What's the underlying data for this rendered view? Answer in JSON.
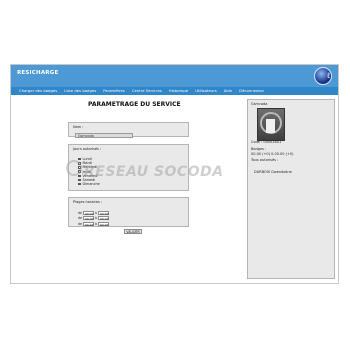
{
  "app": {
    "name": "RESICHARGE",
    "logo_icon": "globe-logo-icon"
  },
  "nav": {
    "items": [
      "Charger des badges",
      "Liste des badges",
      "Paramètres",
      "Centre Services",
      "Historique",
      "Utilisateurs",
      "Aide",
      "Déconnexion"
    ]
  },
  "main": {
    "title": "PARAMETRAGE DU SERVICE",
    "nom_label": "Nom :",
    "nom_value": "Gsmcoda",
    "jours_label": "Jours autorisés :",
    "days": [
      "Lundi",
      "Mardi",
      "Mercredi",
      "Jeudi",
      "Vendredi",
      "Samedi",
      "Dimanche"
    ],
    "plages_label": "Plages horaires :",
    "plages": [
      {
        "de_label": "de",
        "from": "00:00",
        "a_label": "à",
        "to": "00:00"
      },
      {
        "de_label": "de",
        "from": "00:00",
        "a_label": "à",
        "to": "00:00"
      },
      {
        "de_label": "de",
        "from": "00:00",
        "a_label": "à",
        "to": "00:00"
      }
    ],
    "submit": "VALIDER"
  },
  "side": {
    "header": "Gsmcoda",
    "code_label": "Code : 00002801",
    "badges_label": "Badges :",
    "badges_value": "00.00 (+0) 0.00.00 (+0)",
    "users_label": "Tous autorisés :",
    "person": "DURBOIS Gwendoline"
  },
  "watermark": "RESEAU SOCODA"
}
